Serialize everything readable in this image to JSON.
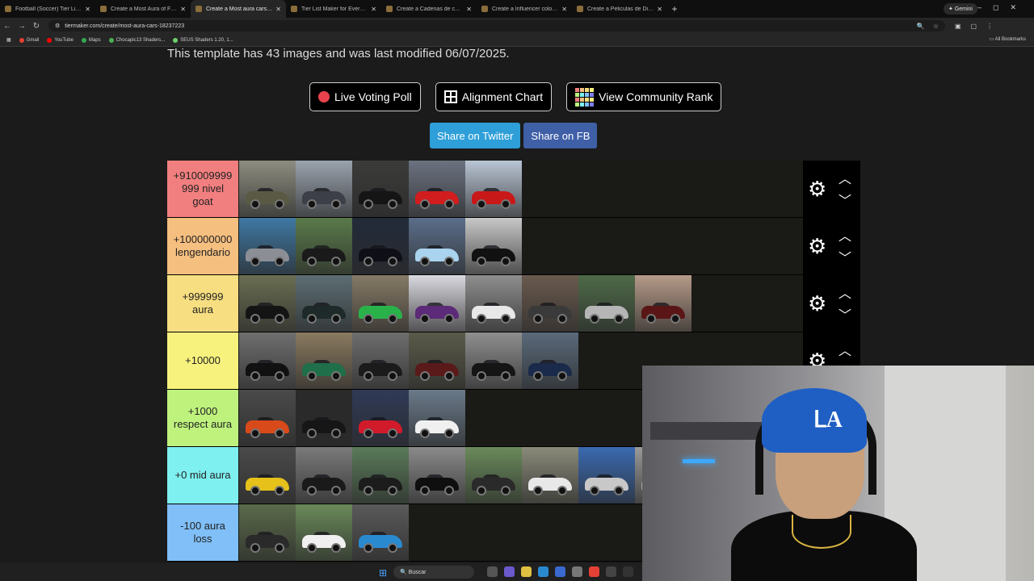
{
  "browser": {
    "tabs": [
      {
        "title": "Football (Soccer) Tier List Temp",
        "active": false
      },
      {
        "title": "Create a Most Aura of Fictional",
        "active": false
      },
      {
        "title": "Create a Most aura cars Tier Lis",
        "active": true
      },
      {
        "title": "Tier List Maker for Everything -",
        "active": false
      },
      {
        "title": "Create a Cadenas de comidas r",
        "active": false
      },
      {
        "title": "Create a Influencer colombian",
        "active": false
      },
      {
        "title": "Create a Peliculas de Disney + T",
        "active": false
      }
    ],
    "new_tab": "+",
    "gemini": "Gemini",
    "url": "tiermaker.com/create/most-aura-cars-18237223",
    "bookmarks": [
      "Gmail",
      "YouTube",
      "Maps",
      "Chocapic13 Shaders...",
      "SEUS Shaders 1.20, 1..."
    ],
    "all_bookmarks": "All Bookmarks"
  },
  "page": {
    "info_text": "This template has 43 images and was last modified 06/07/2025.",
    "buttons": {
      "live_voting": "Live Voting Poll",
      "alignment": "Alignment Chart",
      "community": "View Community Rank"
    },
    "share": {
      "twitter": "Share on Twitter",
      "fb": "Share on FB"
    }
  },
  "tiers": [
    {
      "label": "+910009999 999 nivel goat",
      "color": "#f27f7f",
      "items": [
        {
          "car": "#5a5a44",
          "bg": "#8d8d80"
        },
        {
          "car": "#3c3f47",
          "bg": "#9aa3ae"
        },
        {
          "car": "#151515",
          "bg": "#3b3c3a"
        },
        {
          "car": "#d11d1d",
          "bg": "#6b7280"
        },
        {
          "car": "#c91818",
          "bg": "#b9c5d4"
        }
      ]
    },
    {
      "label": "+100000000 lengendario",
      "color": "#f5bf80",
      "items": [
        {
          "car": "#8b8f95",
          "bg": "#3f78a3"
        },
        {
          "car": "#1a1a1a",
          "bg": "#5a7a4a"
        },
        {
          "car": "#0f0f18",
          "bg": "#232b3a"
        },
        {
          "car": "#a9d3ef",
          "bg": "#5b6e8a"
        },
        {
          "car": "#111111",
          "bg": "#c8c8c8"
        }
      ]
    },
    {
      "label": "+999999 aura",
      "color": "#f7de80",
      "items": [
        {
          "car": "#141414",
          "bg": "#6a6e52"
        },
        {
          "car": "#1e2a2a",
          "bg": "#5c6e74"
        },
        {
          "car": "#29b24a",
          "bg": "#867a66"
        },
        {
          "car": "#5c2a78",
          "bg": "#d9d9e0"
        },
        {
          "car": "#e8e8e8",
          "bg": "#8e8e8e"
        },
        {
          "car": "#3a3a3a",
          "bg": "#6a5a4e"
        },
        {
          "car": "#b5b5b5",
          "bg": "#4e6a48"
        },
        {
          "car": "#5a1616",
          "bg": "#b59a88"
        }
      ]
    },
    {
      "label": "+10000",
      "color": "#f7f27d",
      "items": [
        {
          "car": "#111111",
          "bg": "#6f6f6f"
        },
        {
          "car": "#1f6f4a",
          "bg": "#8a7a60"
        },
        {
          "car": "#1b1b1b",
          "bg": "#6e6e6e"
        },
        {
          "car": "#5a1a1a",
          "bg": "#5a5a4a"
        },
        {
          "car": "#151515",
          "bg": "#8f8f8f"
        },
        {
          "car": "#1a2a4a",
          "bg": "#5a6a7a"
        }
      ]
    },
    {
      "label": "+1000 respect aura",
      "color": "#bef27d",
      "items": [
        {
          "car": "#d84a1a",
          "bg": "#4a4a4a"
        },
        {
          "car": "#161616",
          "bg": "#2a2a2a"
        },
        {
          "car": "#d11a2a",
          "bg": "#2f3a56"
        },
        {
          "car": "#f0f0f0",
          "bg": "#6a7a8a"
        }
      ]
    },
    {
      "label": "+0 mid aura",
      "color": "#7ff0f0",
      "items": [
        {
          "car": "#e5c11a",
          "bg": "#4a4a4a"
        },
        {
          "car": "#1a1a1a",
          "bg": "#7a7a7a"
        },
        {
          "car": "#1c1c1c",
          "bg": "#5a7a5a"
        },
        {
          "car": "#0f0f0f",
          "bg": "#8a8a8a"
        },
        {
          "car": "#2a2a2a",
          "bg": "#6a8a5a"
        },
        {
          "car": "#e8e8e8",
          "bg": "#8a8a7a"
        },
        {
          "car": "#c8c8c8",
          "bg": "#3a6ab0"
        },
        {
          "car": "#aaaaaa",
          "bg": "#9a9a9a"
        }
      ]
    },
    {
      "label": "-100 aura loss",
      "color": "#80bff7",
      "items": [
        {
          "car": "#2a2a2a",
          "bg": "#5a6a4a"
        },
        {
          "car": "#f0f0f0",
          "bg": "#6a8a5a"
        },
        {
          "car": "#2a8ad0",
          "bg": "#5a5a5a"
        }
      ]
    }
  ],
  "taskbar": {
    "search_label": "Buscar"
  }
}
